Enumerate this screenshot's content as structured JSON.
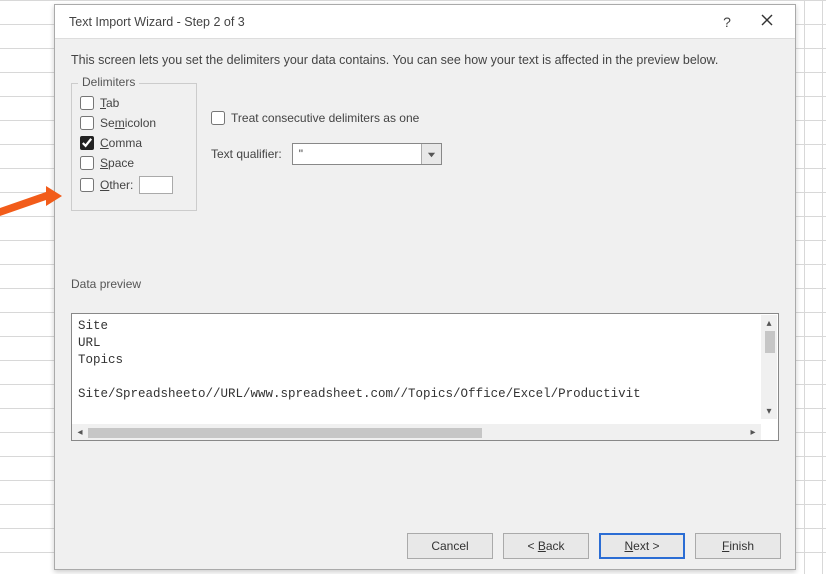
{
  "window": {
    "title": "Text Import Wizard - Step 2 of 3"
  },
  "description": "This screen lets you set the delimiters your data contains.  You can see how your text is affected in the preview below.",
  "delimiters": {
    "legend": "Delimiters",
    "tab": {
      "label_pre": "",
      "accel": "T",
      "label_post": "ab",
      "checked": false
    },
    "semicolon": {
      "label_pre": "Se",
      "accel": "m",
      "label_post": "icolon",
      "checked": false
    },
    "comma": {
      "label_pre": "",
      "accel": "C",
      "label_post": "omma",
      "checked": true
    },
    "space": {
      "label_pre": "",
      "accel": "S",
      "label_post": "pace",
      "checked": false
    },
    "other": {
      "label_pre": "",
      "accel": "O",
      "label_post": "ther:",
      "checked": false,
      "value": ""
    }
  },
  "treat_one": {
    "label_pre": "T",
    "accel": "r",
    "label_post": "eat consecutive delimiters as one",
    "checked": false
  },
  "qualifier": {
    "label_pre": "Text ",
    "accel": "q",
    "label_post": "ualifier:",
    "value": "\""
  },
  "preview": {
    "legend_pre": "Data ",
    "legend_accel": "p",
    "legend_post": "review",
    "lines": [
      "Site",
      "URL",
      "Topics",
      "",
      "Site/Spreadsheeto//URL/www.spreadsheet.com//Topics/Office/Excel/Productivit"
    ]
  },
  "buttons": {
    "cancel": "Cancel",
    "back_pre": "< ",
    "back_accel": "B",
    "back_post": "ack",
    "next_pre": "",
    "next_accel": "N",
    "next_post": "ext >",
    "finish_pre": "",
    "finish_accel": "F",
    "finish_post": "inish"
  }
}
